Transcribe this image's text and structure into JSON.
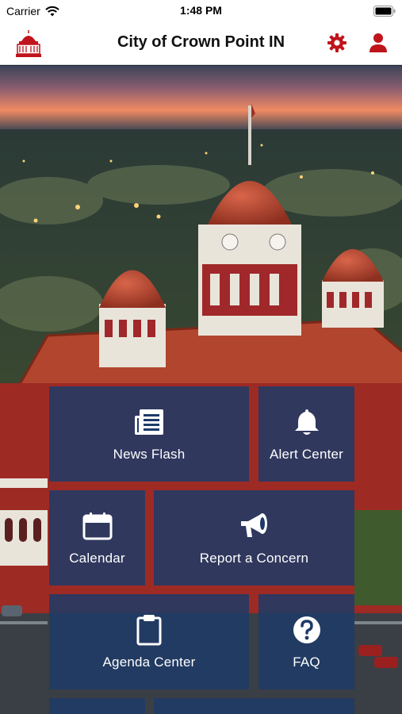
{
  "status_bar": {
    "carrier": "Carrier",
    "time": "1:48 PM"
  },
  "header": {
    "title": "City of Crown Point IN",
    "accent_color": "#c0141c"
  },
  "tiles": [
    {
      "id": "news",
      "label": "News Flash",
      "icon": "newspaper-icon"
    },
    {
      "id": "alert",
      "label": "Alert Center",
      "icon": "bell-icon"
    },
    {
      "id": "calendar",
      "label": "Calendar",
      "icon": "calendar-icon"
    },
    {
      "id": "report",
      "label": "Report a Concern",
      "icon": "megaphone-icon"
    },
    {
      "id": "agenda",
      "label": "Agenda Center",
      "icon": "clipboard-icon"
    },
    {
      "id": "faq",
      "label": "FAQ",
      "icon": "question-icon"
    }
  ],
  "colors": {
    "tile_bg": "#1e3a68",
    "header_bg": "#ffffff"
  }
}
